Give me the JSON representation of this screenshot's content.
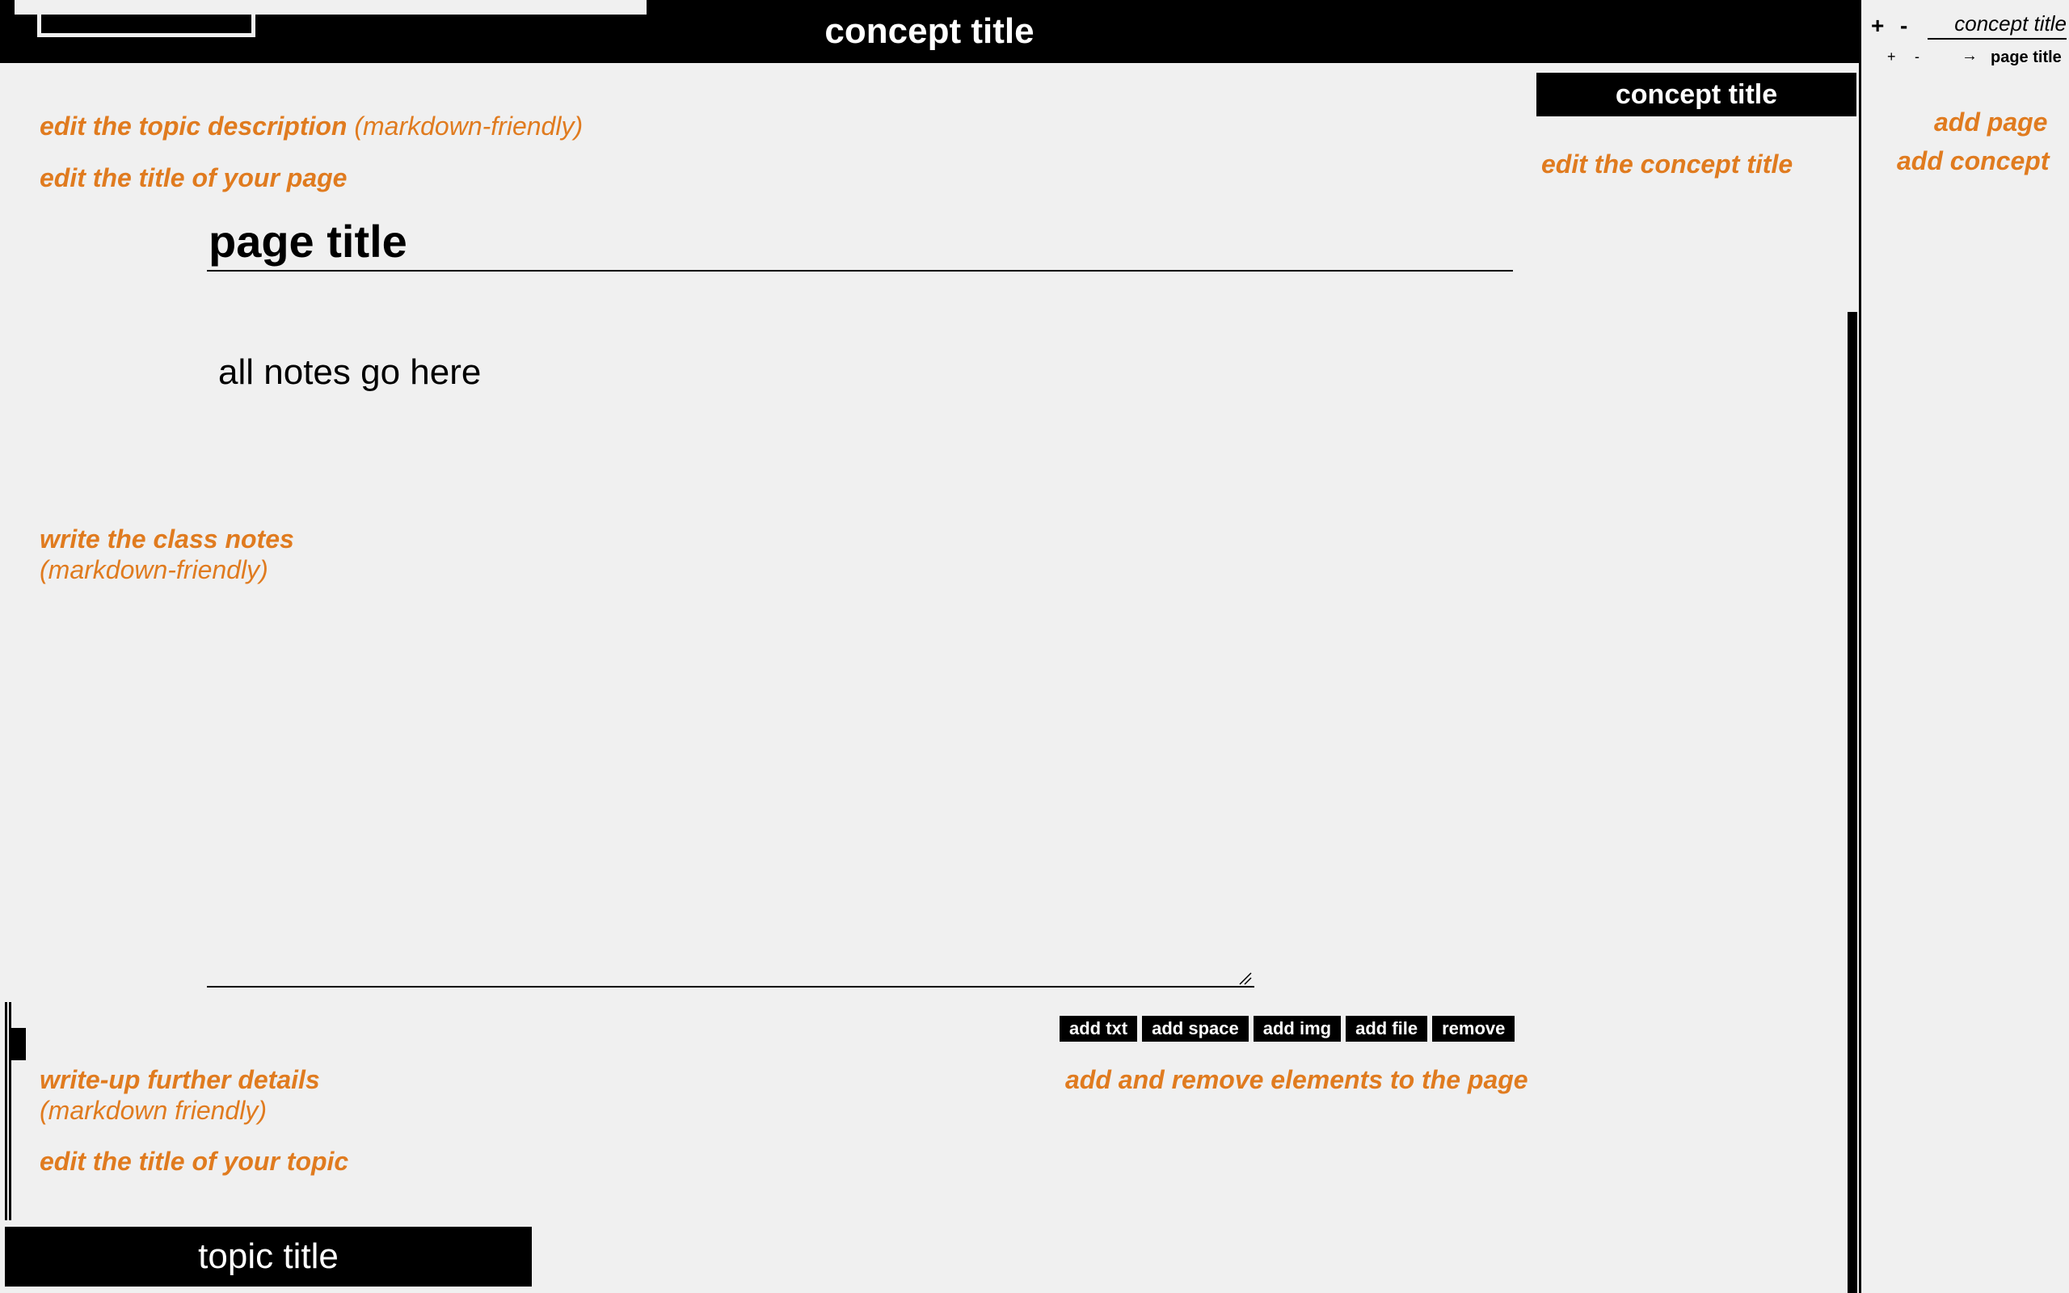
{
  "header": {
    "concept_title": "concept title"
  },
  "hints": {
    "topic_description": "edit the topic description",
    "topic_description_suffix": "(markdown-friendly)",
    "page_title": "edit the title of your page",
    "class_notes": "write the class notes",
    "class_notes_suffix": "(markdown-friendly)",
    "further_details": "write-up further details",
    "further_details_suffix": "(markdown friendly)",
    "topic_title": "edit the title of your topic",
    "elements": "add and remove elements to the page",
    "concept_title": "edit the concept title",
    "add_page": "add page",
    "add_concept": "add concept"
  },
  "editor": {
    "page_title": "page title",
    "notes": "all notes go here"
  },
  "element_toolbar": {
    "add_txt": "add txt",
    "add_space": "add space",
    "add_img": "add img",
    "add_file": "add file",
    "remove": "remove"
  },
  "topic": {
    "title": "topic title"
  },
  "concept_panel": {
    "title": "concept title"
  },
  "sidebar": {
    "concept_plus": "+",
    "concept_minus": "-",
    "concept_title": "concept title",
    "page_plus": "+",
    "page_minus": "-",
    "page_arrow": "→",
    "page_title": "page title"
  },
  "colors": {
    "hint": "#e07b1f",
    "background": "#f0f0f0",
    "bar": "#000000"
  },
  "icons": [
    "resize-grip-icon",
    "arrow-right-icon"
  ]
}
